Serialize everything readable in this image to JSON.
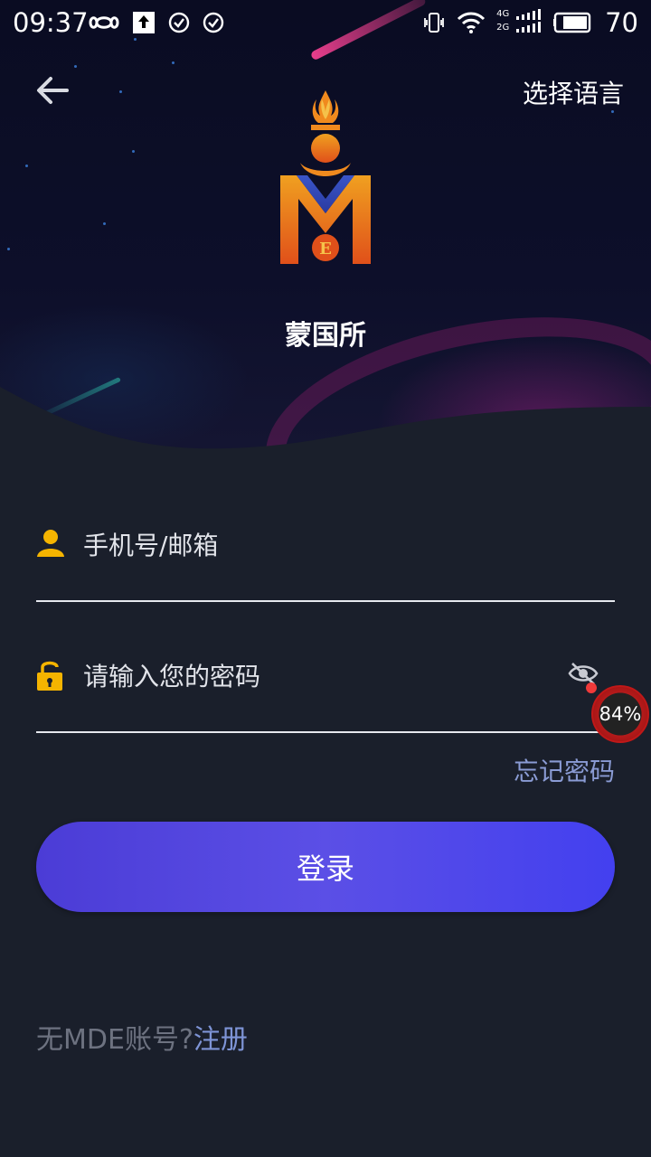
{
  "status_bar": {
    "time": "09:37",
    "battery": "70",
    "network_top": "4G",
    "network_bottom": "2G",
    "icons": [
      "infinity-icon",
      "upload-icon",
      "check-circle-icon",
      "check-circle-icon",
      "vibrate-icon",
      "wifi-icon",
      "signal-icon",
      "battery-icon"
    ]
  },
  "nav": {
    "back_icon": "back-arrow-icon",
    "language_label": "选择语言"
  },
  "brand": {
    "name": "蒙国所",
    "logo_icon": "mde-logo-icon"
  },
  "form": {
    "username_placeholder": "手机号/邮箱",
    "password_placeholder": "请输入您的密码",
    "forgot_label": "忘记密码",
    "login_label": "登录",
    "user_icon": "user-icon",
    "lock_icon": "lock-icon",
    "eye_icon": "eye-hidden-icon"
  },
  "floating_badge": {
    "value": "84%"
  },
  "register": {
    "question": "无MDE账号?",
    "link_label": "注册"
  },
  "colors": {
    "background": "#1a1f2b",
    "accent": "#4b3cd6",
    "link": "#7e94d6",
    "icon_gold": "#f5b400"
  }
}
